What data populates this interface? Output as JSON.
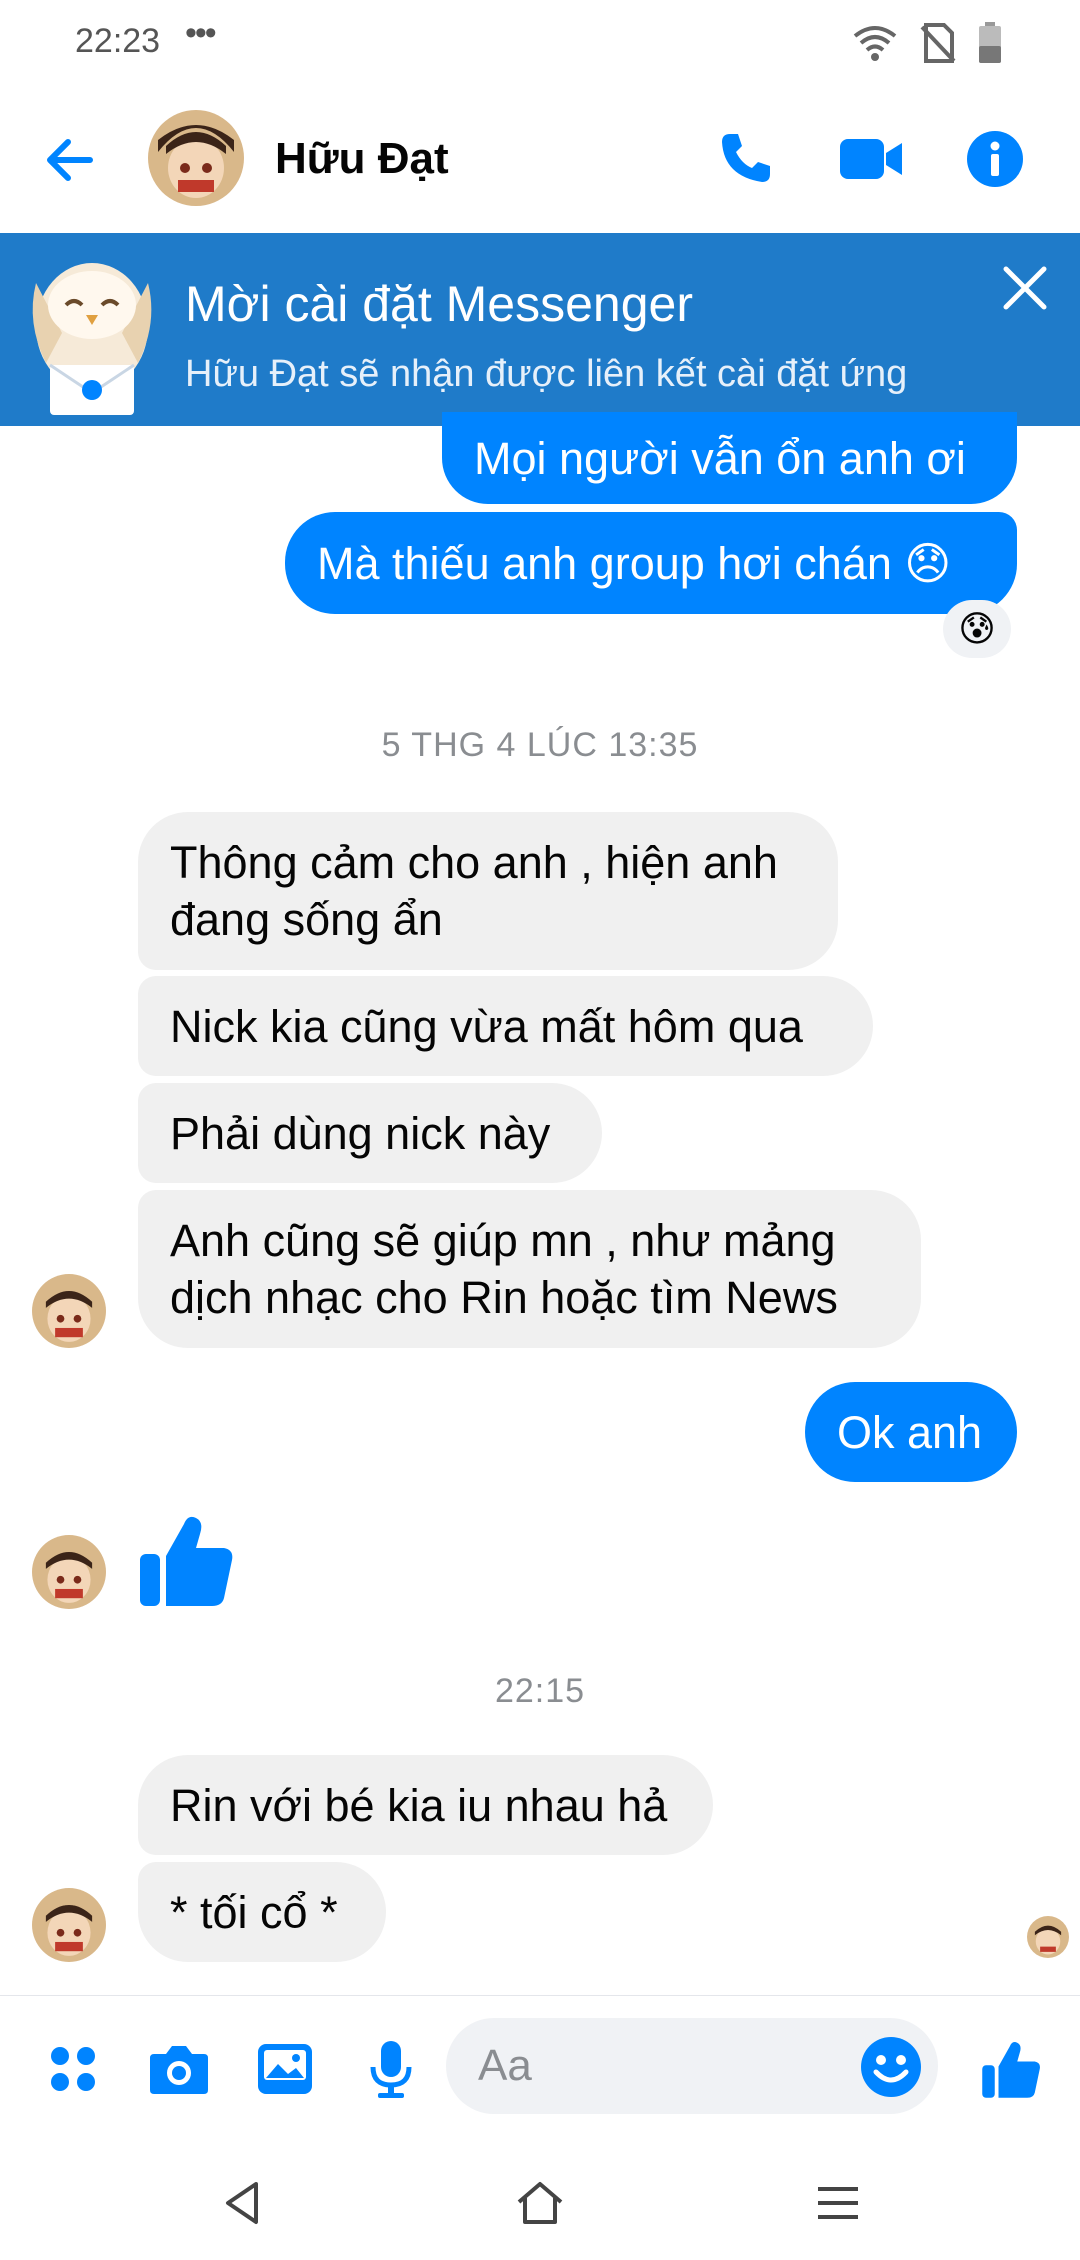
{
  "status_bar": {
    "time": "22:23",
    "dots": "•••"
  },
  "header": {
    "contact_name": "Hữu Đạt"
  },
  "banner": {
    "title": "Mời cài đặt Messenger",
    "subtitle": "Hữu Đạt sẽ nhận được liên kết cài đặt ứng"
  },
  "messages": [
    {
      "dir": "out",
      "text": "Mọi người vẫn ổn anh ơi"
    },
    {
      "dir": "out",
      "text": "Mà thiếu anh group hơi chán 😞"
    },
    {
      "dir": "in",
      "text": "Thông cảm cho anh , hiện anh\nđang sống ẩn"
    },
    {
      "dir": "in",
      "text": "Nick kia cũng vừa mất hôm qua"
    },
    {
      "dir": "in",
      "text": "Phải dùng nick này"
    },
    {
      "dir": "in",
      "text": "Anh cũng sẽ giúp mn , như mảng\ndịch nhạc cho Rin hoặc tìm News"
    },
    {
      "dir": "out",
      "text": "Ok anh"
    },
    {
      "dir": "in",
      "text": "Rin với bé kia iu nhau hả"
    },
    {
      "dir": "in",
      "text": "* tối cổ *"
    }
  ],
  "reaction": "😰",
  "timestamps": [
    "5 THG 4 LÚC 13:35",
    "22:15"
  ],
  "composer": {
    "placeholder": "Aa"
  },
  "colors": {
    "accent": "#0084ff",
    "banner": "#1f7bc9",
    "incoming_bubble": "#f0f0f0"
  }
}
